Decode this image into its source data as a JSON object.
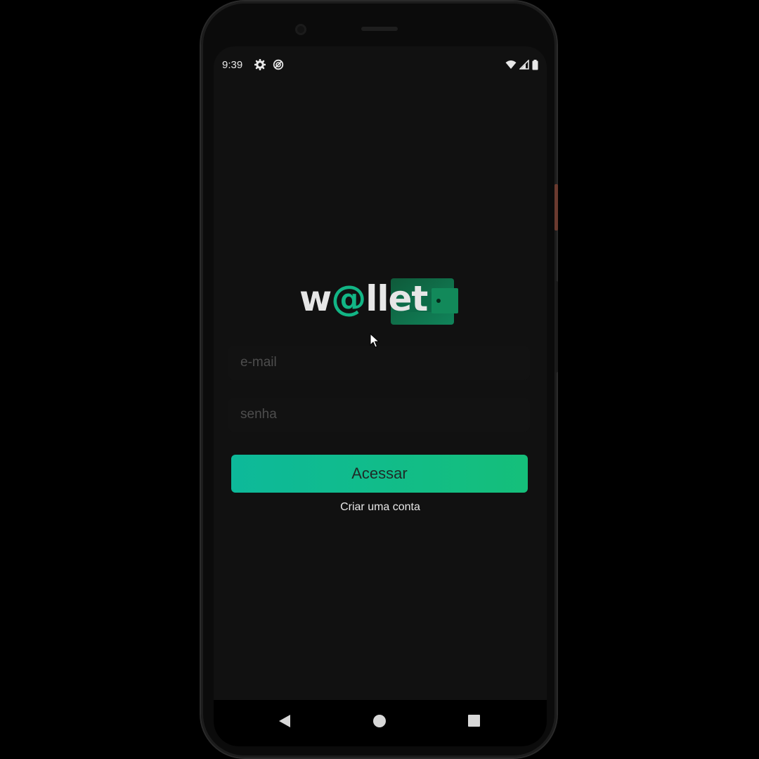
{
  "status_bar": {
    "time": "9:39",
    "left_icons": [
      "gear-icon",
      "sync-icon"
    ],
    "right_icons": [
      "wifi-icon",
      "signal-icon",
      "battery-icon"
    ]
  },
  "logo": {
    "text_before": "w",
    "at_symbol": "@",
    "text_after": "llet",
    "accent_color": "#12b585"
  },
  "login_form": {
    "email_placeholder": "e-mail",
    "email_value": "",
    "password_placeholder": "senha",
    "password_value": "",
    "submit_label": "Acessar",
    "create_account_label": "Criar uma conta"
  },
  "nav_bar": {
    "icons": [
      "back-icon",
      "home-icon",
      "recents-icon"
    ]
  },
  "colors": {
    "screen_background": "#111111",
    "button_gradient_start": "#0db99a",
    "button_gradient_end": "#15bf7a",
    "text_light": "#e8e8e8"
  }
}
